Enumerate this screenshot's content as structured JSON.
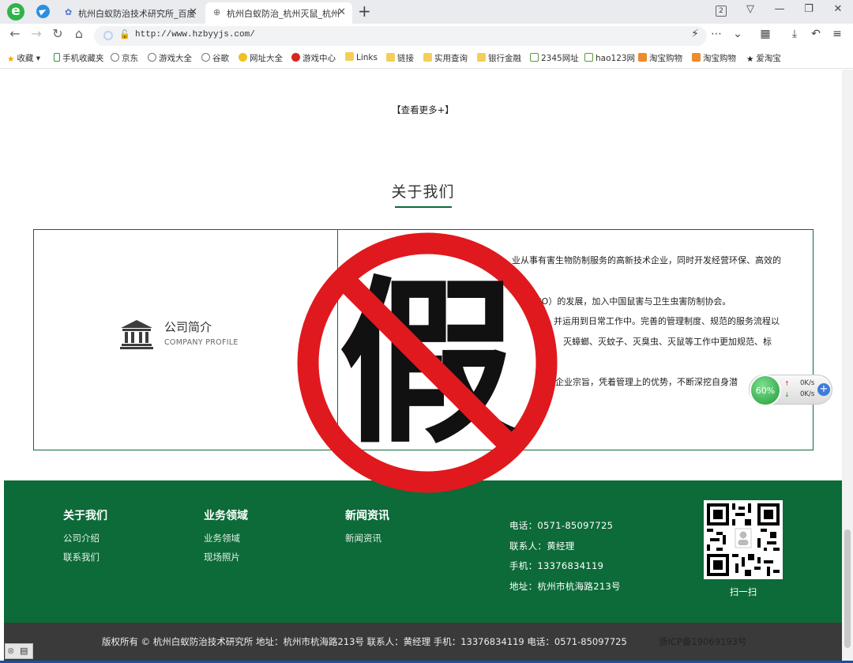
{
  "browser": {
    "tabs": [
      {
        "label": "杭州白蚁防治技术研究所_百度",
        "active": false
      },
      {
        "label": "杭州白蚁防治_杭州灭鼠_杭州",
        "active": true
      }
    ],
    "tab_count": "2",
    "url": "http://www.hzbyyjs.com/",
    "bookmarks": [
      {
        "label": "收藏",
        "icon": "star-icon"
      },
      {
        "label": "手机收藏夹",
        "icon": "phone-icon"
      },
      {
        "label": "京东",
        "icon": "globe-icon"
      },
      {
        "label": "游戏大全",
        "icon": "globe-icon"
      },
      {
        "label": "谷歌",
        "icon": "globe-icon"
      },
      {
        "label": "网址大全",
        "icon": "site-icon"
      },
      {
        "label": "游戏中心",
        "icon": "game-icon"
      },
      {
        "label": "Links",
        "icon": "folder-icon"
      },
      {
        "label": "链接",
        "icon": "folder-icon"
      },
      {
        "label": "实用查询",
        "icon": "folder-icon"
      },
      {
        "label": "银行金融",
        "icon": "folder-icon"
      },
      {
        "label": "2345网址",
        "icon": "home-icon"
      },
      {
        "label": "hao123网",
        "icon": "home-icon"
      },
      {
        "label": "淘宝购物",
        "icon": "taobao-icon"
      },
      {
        "label": "淘宝购物",
        "icon": "taobao-icon"
      },
      {
        "label": "爱淘宝",
        "icon": "star-icon"
      }
    ]
  },
  "page": {
    "more_link": "【查看更多+】",
    "about_title": "关于我们",
    "company_profile": {
      "title": "公司简介",
      "subtitle": "COMPANY PROFILE"
    },
    "about_lines": [
      "业从事有害生物防制服务的高新技术企业，同时开发经营环保、高效的",
      "CO）的发展，加入中国鼠害与卫生虫害防制协会。",
      "并运用到日常工作中。完善的管理制度、规范的服务流程以",
      "灭蟑螂、灭蚊子、灭臭虫、灭鼠等工作中更加规范、标",
      "企业宗旨，凭着管理上的优势，不断深挖自身潜"
    ],
    "stamp_text": "假"
  },
  "footer": {
    "columns": [
      {
        "title": "关于我们",
        "links": [
          "公司介绍",
          "联系我们"
        ]
      },
      {
        "title": "业务领域",
        "links": [
          "业务领域",
          "现场照片"
        ]
      },
      {
        "title": "新闻资讯",
        "links": [
          "新闻资讯"
        ]
      }
    ],
    "contact": [
      "电话：0571-85097725",
      "联系人：黄经理",
      "手机：13376834119",
      "地址：杭州市杭海路213号"
    ],
    "qr_label": "扫一扫",
    "copyright": "版权所有 © 杭州白蚁防治技术研究所    地址：杭州市杭海路213号    联系人：黄经理    手机：13376834119    电话：0571-85097725",
    "icp": "浙ICP备19069193号"
  },
  "speed_widget": {
    "percent": "60%",
    "up": "0K/s",
    "down": "0K/s"
  },
  "colors": {
    "brand_green": "#0c6b38",
    "stamp_red": "#e0191e"
  }
}
